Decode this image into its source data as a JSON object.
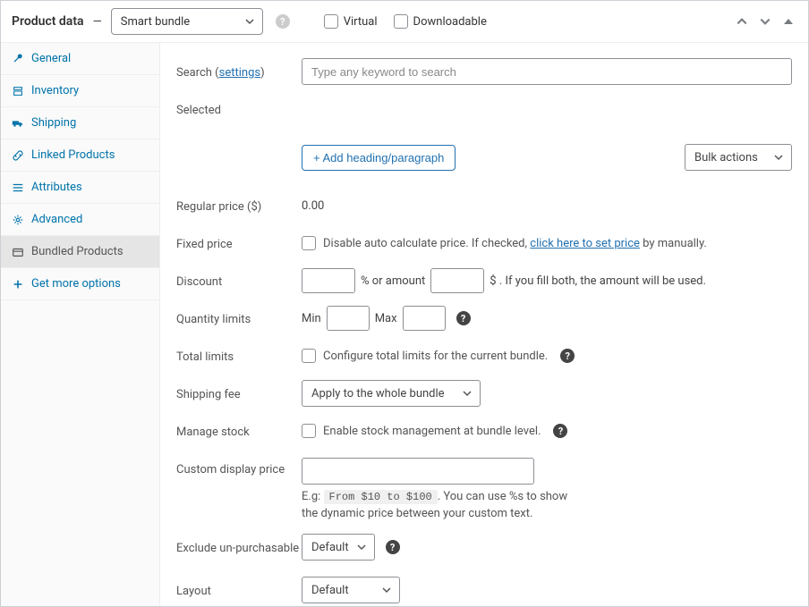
{
  "header": {
    "title": "Product data",
    "type_value": "Smart bundle",
    "virtual_label": "Virtual",
    "downloadable_label": "Downloadable"
  },
  "sidebar": {
    "items": [
      {
        "label": "General"
      },
      {
        "label": "Inventory"
      },
      {
        "label": "Shipping"
      },
      {
        "label": "Linked Products"
      },
      {
        "label": "Attributes"
      },
      {
        "label": "Advanced"
      },
      {
        "label": "Bundled Products"
      },
      {
        "label": "Get more options"
      }
    ]
  },
  "fields": {
    "search": {
      "label": "Search",
      "settings": "settings",
      "placeholder": "Type any keyword to search"
    },
    "selected": {
      "label": "Selected"
    },
    "add_heading": "+ Add heading/paragraph",
    "bulk_actions": "Bulk actions",
    "regular_price": {
      "label": "Regular price ($)",
      "value": "0.00"
    },
    "fixed_price": {
      "label": "Fixed price",
      "text1": "Disable auto calculate price. If checked, ",
      "link": "click here to set price",
      "text2": " by manually."
    },
    "discount": {
      "label": "Discount",
      "mid": "% or amount",
      "suffix": "$ . If you fill both, the amount will be used."
    },
    "qty_limits": {
      "label": "Quantity limits",
      "min": "Min",
      "max": "Max"
    },
    "total_limits": {
      "label": "Total limits",
      "text": "Configure total limits for the current bundle."
    },
    "shipping_fee": {
      "label": "Shipping fee",
      "value": "Apply to the whole bundle"
    },
    "manage_stock": {
      "label": "Manage stock",
      "text": "Enable stock management at bundle level."
    },
    "custom_display_price": {
      "label": "Custom display price",
      "eg_prefix": "E.g: ",
      "eg_code": "From $10 to $100",
      "eg_suffix": ". You can use %s to show",
      "line2": "the dynamic price between your custom text."
    },
    "exclude": {
      "label": "Exclude un-purchasable",
      "value": "Default"
    },
    "layout": {
      "label": "Layout",
      "value": "Default"
    }
  }
}
